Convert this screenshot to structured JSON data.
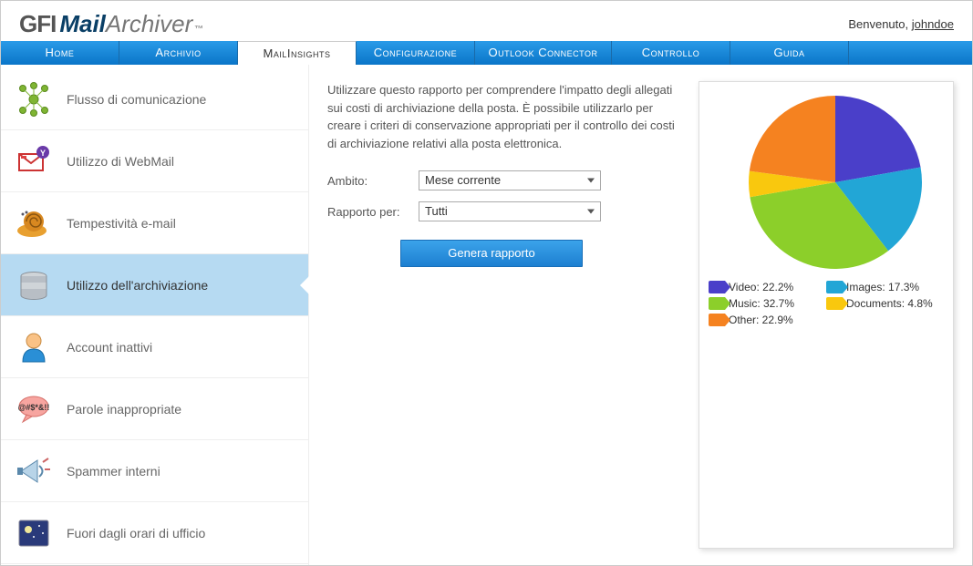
{
  "header": {
    "logo_gfi": "GFI",
    "logo_mail": "Mail",
    "logo_archiver": "Archiver",
    "welcome_prefix": "Benvenuto, ",
    "username": "johndoe"
  },
  "nav": {
    "items": [
      {
        "label": "Home"
      },
      {
        "label": "Archivio"
      },
      {
        "label": "MailInsights",
        "active": true
      },
      {
        "label": "Configurazione"
      },
      {
        "label": "Outlook Connector"
      },
      {
        "label": "Controllo"
      },
      {
        "label": "Guida"
      }
    ]
  },
  "sidebar": {
    "items": [
      {
        "label": "Flusso di comunicazione"
      },
      {
        "label": "Utilizzo di WebMail"
      },
      {
        "label": "Tempestività e-mail"
      },
      {
        "label": "Utilizzo dell'archiviazione",
        "active": true
      },
      {
        "label": "Account inattivi"
      },
      {
        "label": "Parole inappropriate"
      },
      {
        "label": "Spammer interni"
      },
      {
        "label": "Fuori dagli orari di ufficio"
      }
    ]
  },
  "main": {
    "description": "Utilizzare questo rapporto per comprendere l'impatto degli allegati sui costi di archiviazione della posta. È possibile utilizzarlo per creare i criteri di conservazione appropriati per il controllo dei costi di archiviazione relativi alla posta elettronica.",
    "scope_label": "Ambito:",
    "scope_value": "Mese corrente",
    "report_for_label": "Rapporto per:",
    "report_for_value": "Tutti",
    "generate_label": "Genera rapporto"
  },
  "chart_data": {
    "type": "pie",
    "title": "",
    "series": [
      {
        "name": "Video",
        "value": 22.2,
        "color": "#4a3fc9"
      },
      {
        "name": "Images",
        "value": 17.3,
        "color": "#22a6d6"
      },
      {
        "name": "Music",
        "value": 32.7,
        "color": "#8ccf2a"
      },
      {
        "name": "Documents",
        "value": 4.8,
        "color": "#f9c80e"
      },
      {
        "name": "Other",
        "value": 22.9,
        "color": "#f58220"
      }
    ],
    "legend_layout": [
      [
        "Video",
        "Images"
      ],
      [
        "Music",
        "Documents"
      ],
      [
        "Other"
      ]
    ]
  }
}
